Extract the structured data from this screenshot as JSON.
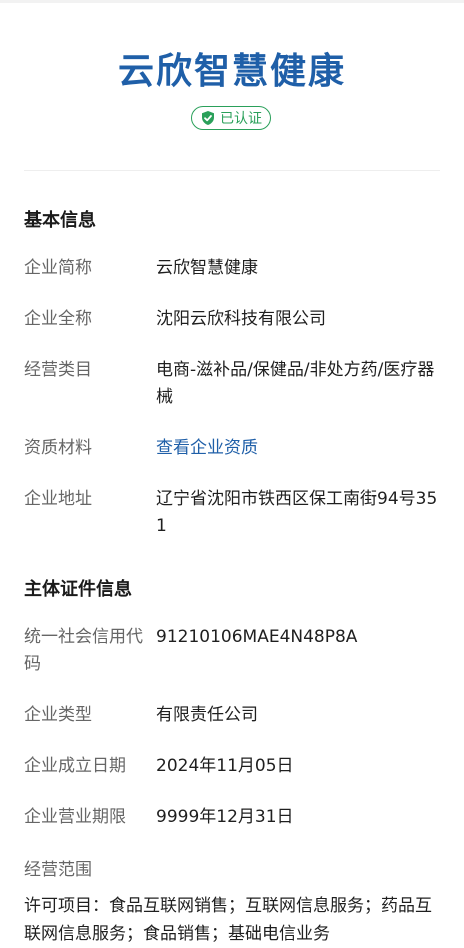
{
  "header": {
    "company_name": "云欣智慧健康",
    "verified_badge": "已认证"
  },
  "basic_info": {
    "title": "基本信息",
    "rows": [
      {
        "label": "企业简称",
        "value": "云欣智慧健康"
      },
      {
        "label": "企业全称",
        "value": "沈阳云欣科技有限公司"
      },
      {
        "label": "经营类目",
        "value": "电商-滋补品/保健品/非处方药/医疗器械"
      },
      {
        "label": "资质材料",
        "value": "查看企业资质"
      },
      {
        "label": "企业地址",
        "value": "辽宁省沈阳市铁西区保工南街94号351"
      }
    ]
  },
  "license_info": {
    "title": "主体证件信息",
    "rows": [
      {
        "label": "统一社会信用代码",
        "value": "91210106MAE4N48P8A"
      },
      {
        "label": "企业类型",
        "value": "有限责任公司"
      },
      {
        "label": "企业成立日期",
        "value": "2024年11月05日"
      },
      {
        "label": "企业营业期限",
        "value": "9999年12月31日"
      }
    ],
    "scope_label": "经营范围",
    "scope_text": "许可项目：食品互联网销售；互联网信息服务；药品互联网信息服务；食品销售；基础电信业务"
  },
  "colors": {
    "brand": "#1f5fa8",
    "verified": "#2aa05a",
    "label": "#666666"
  }
}
